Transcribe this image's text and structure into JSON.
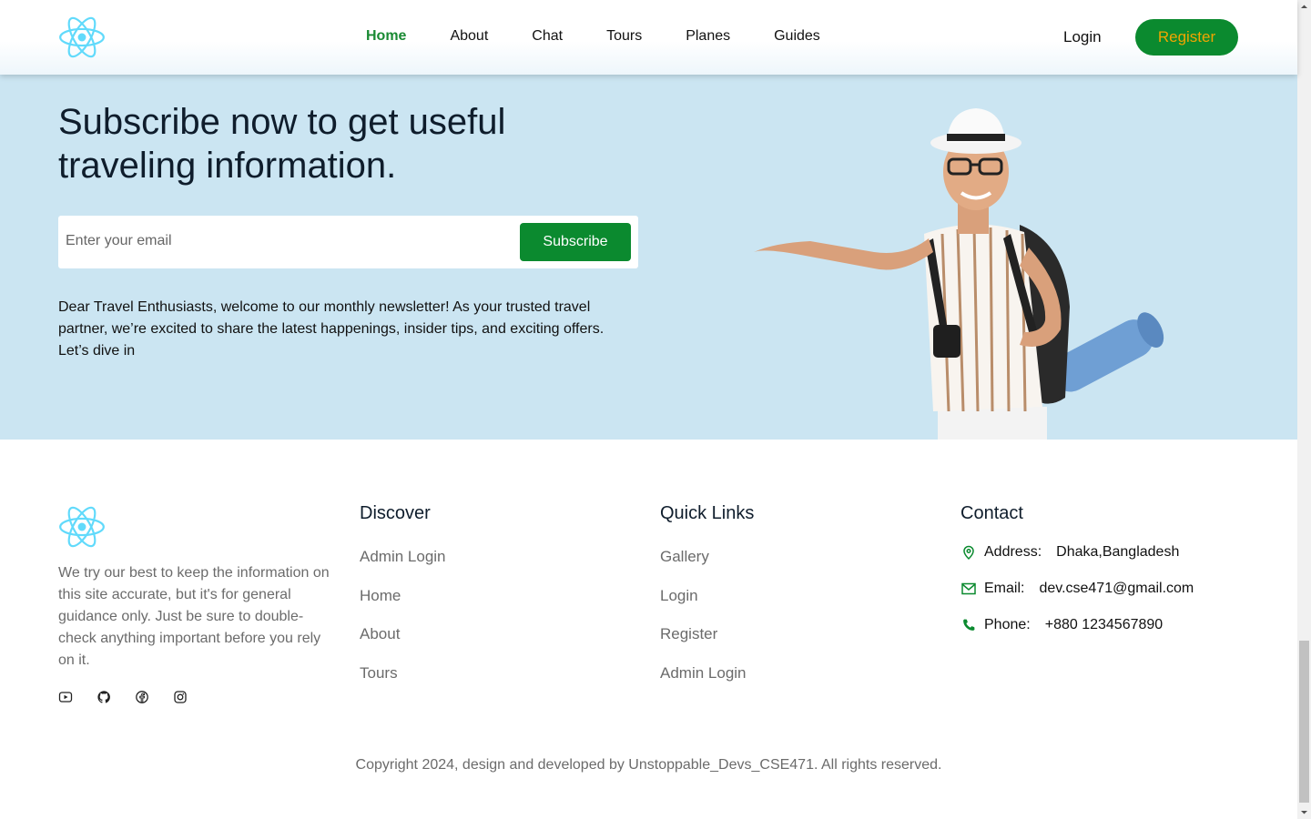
{
  "header": {
    "nav": [
      "Home",
      "About",
      "Chat",
      "Tours",
      "Planes",
      "Guides"
    ],
    "active_nav": "Home",
    "login_label": "Login",
    "register_label": "Register"
  },
  "newsletter": {
    "title": "Subscribe now to get useful traveling information.",
    "email_placeholder": "Enter your email",
    "subscribe_label": "Subscribe",
    "text": "Dear Travel Enthusiasts, welcome to our monthly newsletter! As your trusted travel partner, we’re excited to share the latest happenings, insider tips, and exciting offers. Let’s dive in"
  },
  "footer": {
    "about": "We try our best to keep the information on this site accurate, but it's for general guidance only. Just be sure to double-check anything important before you rely on it.",
    "socials": [
      "youtube-icon",
      "github-icon",
      "facebook-icon",
      "instagram-icon"
    ],
    "discover": {
      "title": "Discover",
      "links": [
        "Admin Login",
        "Home",
        "About",
        "Tours"
      ]
    },
    "quick_links": {
      "title": "Quick Links",
      "links": [
        "Gallery",
        "Login",
        "Register",
        "Admin Login"
      ]
    },
    "contact": {
      "title": "Contact",
      "address_label": "Address:",
      "address": "Dhaka,Bangladesh",
      "email_label": "Email:",
      "email": "dev.cse471@gmail.com",
      "phone_label": "Phone:",
      "phone": "+880 1234567890"
    },
    "copyright": "Copyright 2024, design and developed by Unstoppable_Devs_CSE471. All rights reserved."
  },
  "colors": {
    "accent": "#0b8a2f",
    "register_text": "#f0a500",
    "newsletter_bg": "#cbe5f2",
    "logo": "#61dafb"
  }
}
